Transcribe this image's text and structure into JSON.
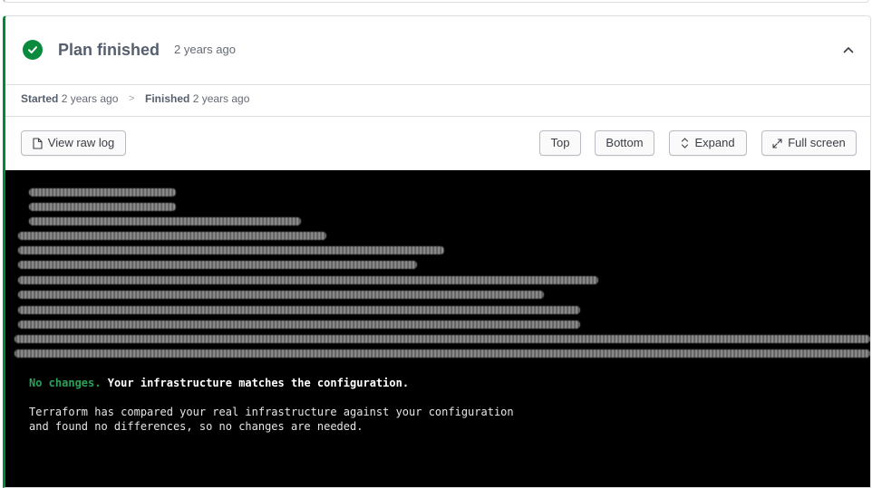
{
  "job": {
    "title": "Plan finished",
    "relative_time": "2 years ago",
    "status": "success",
    "status_icon": "check-circle-icon",
    "collapse_icon": "chevron-up-icon"
  },
  "timeline": {
    "started_label": "Started",
    "started_time": "2 years ago",
    "separator": ">",
    "finished_label": "Finished",
    "finished_time": "2 years ago"
  },
  "toolbar": {
    "view_raw_log": "View raw log",
    "top": "Top",
    "bottom": "Bottom",
    "expand": "Expand",
    "full_screen": "Full screen"
  },
  "log": {
    "summary_status": "No changes.",
    "summary_message": "Your infrastructure matches the configuration.",
    "detail_line_1": "Terraform has compared your real infrastructure against your configuration",
    "detail_line_2": "and found no differences, so no changes are needed."
  },
  "colors": {
    "success": "#0a8a3c",
    "log_background": "#000000",
    "log_success_text": "#2aa25a"
  }
}
